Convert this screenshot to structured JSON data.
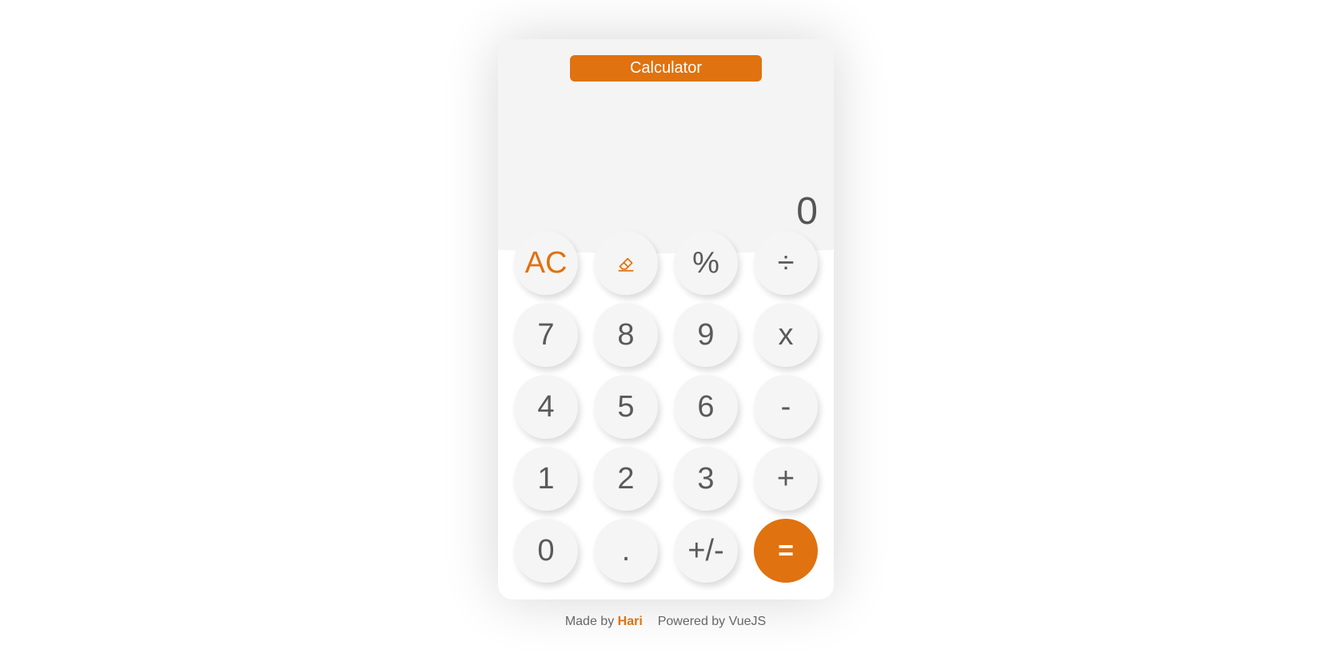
{
  "header": {
    "title": "Calculator"
  },
  "display": {
    "value": "0"
  },
  "keys": {
    "clear": "AC",
    "percent": "%",
    "divide": "÷",
    "seven": "7",
    "eight": "8",
    "nine": "9",
    "multiply": "x",
    "four": "4",
    "five": "5",
    "six": "6",
    "subtract": "-",
    "one": "1",
    "two": "2",
    "three": "3",
    "add": "+",
    "zero": "0",
    "decimal": ".",
    "negate": "+/-",
    "equals": "="
  },
  "icons": {
    "backspace": "eraser-icon"
  },
  "footer": {
    "made_by": "Made by",
    "author": "Hari",
    "powered_by": "Powered by VueJS"
  },
  "colors": {
    "accent": "#e0720f",
    "screen_bg": "#f4f4f4",
    "key_bg": "#f5f5f5",
    "text": "#555555"
  }
}
